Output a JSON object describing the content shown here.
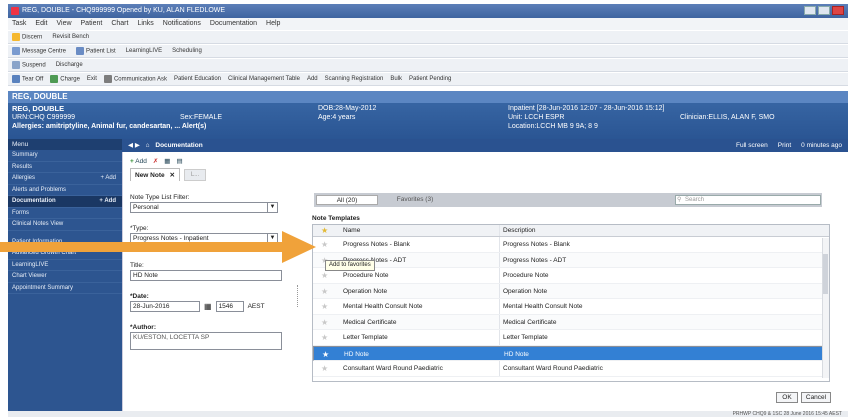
{
  "window": {
    "title": "REG, DOUBLE - CHQ999999 Opened by KU, ALAN FLEDLOWE"
  },
  "menu": [
    "Task",
    "Edit",
    "View",
    "Patient",
    "Chart",
    "Links",
    "Notifications",
    "Documentation",
    "Help"
  ],
  "toolbar_rows": {
    "row1": [
      "Discern",
      "Revisit Bench"
    ],
    "row2": [
      "Message Centre",
      "Patient List",
      "LearningLIVE",
      "Scheduling"
    ],
    "row3": [
      "Suspend",
      "Discharge"
    ],
    "row4": [
      "Tear Off",
      "Charge",
      "Exit",
      "Communication Ask",
      "Patient Education",
      "Clinical Management Table",
      "Add",
      "Scanning Registration",
      "Bulk",
      "Patient Pending"
    ]
  },
  "banner": {
    "name_bar": "REG, DOUBLE",
    "name": "REG, DOUBLE",
    "urn": "URN:CHQ C999999",
    "sex": "Sex:FEMALE",
    "dob": "DOB:28-May-2012",
    "age": "Age:4 years",
    "allergies": "Allergies: amitriptyline, Animal fur, candesartan, ... Alert(s)",
    "inpatient": "Inpatient [28-Jun-2016 12:07 - 28-Jun-2016 15:12]",
    "unit": "Unit: LCCH ESPR",
    "location": "Location:LCCH MB 9 9A; 8 9",
    "clinician": "Clinician:ELLIS, ALAN F, SMO"
  },
  "sidebar": {
    "menu_label": "Menu",
    "items": [
      {
        "label": "Summary",
        "add": ""
      },
      {
        "label": "Results",
        "add": ""
      },
      {
        "label": "Allergies",
        "add": "+ Add"
      },
      {
        "label": "Alerts and Problems",
        "add": ""
      },
      {
        "label": "Documentation",
        "add": "+ Add",
        "active": true
      },
      {
        "label": "Forms",
        "add": ""
      },
      {
        "label": "Clinical Notes View",
        "add": ""
      },
      {
        "label": "Patient Information",
        "add": ""
      },
      {
        "label": "Advanced Growth Chart",
        "add": ""
      },
      {
        "label": "LearningLIVE",
        "add": ""
      },
      {
        "label": "Chart Viewer",
        "add": ""
      },
      {
        "label": "Appointment Summary",
        "add": ""
      }
    ]
  },
  "crumb": {
    "title": "Documentation",
    "fullscreen": "Full screen",
    "print": "Print",
    "refresh": "0 minutes ago"
  },
  "doc_toolbar": {
    "add": "Add"
  },
  "note_tabs": {
    "active": "New Note",
    "second": "L..."
  },
  "form": {
    "note_type_filter_label": "Note Type List Filter:",
    "note_type_filter_value": "Personal",
    "type_label": "*Type:",
    "type_value": "Progress Notes - Inpatient",
    "title_label": "Title:",
    "title_value": "HD Note",
    "date_label": "*Date:",
    "date_value": "28-Jun-2016",
    "time_value": "1546",
    "time_tz": "AEST",
    "author_label": "*Author:",
    "author_value": "KU/ESTON, LOCETTA SP"
  },
  "templates_panel": {
    "tab_all": "All (20)",
    "tab_favorites": "Favorites (3)",
    "search_placeholder": "Search",
    "section_label": "Note Templates",
    "col_name": "Name",
    "col_description": "Description",
    "tooltip": "Add to favorites",
    "rows": [
      {
        "name": "Progress Notes - Blank",
        "description": "Progress Notes - Blank"
      },
      {
        "name": "Progress Notes - ADT",
        "description": "Progress Notes - ADT"
      },
      {
        "name": "Procedure Note",
        "description": "Procedure Note"
      },
      {
        "name": "Operation Note",
        "description": "Operation Note"
      },
      {
        "name": "Mental Health Consult Note",
        "description": "Mental Health Consult Note"
      },
      {
        "name": "Medical Certificate",
        "description": "Medical Certificate"
      },
      {
        "name": "Letter Template",
        "description": "Letter Template"
      },
      {
        "name": "HD Note",
        "description": "HD Note",
        "selected": true
      },
      {
        "name": "Consultant Ward Round Paediatric",
        "description": "Consultant Ward Round Paediatric"
      }
    ]
  },
  "buttons": {
    "ok": "OK",
    "cancel": "Cancel"
  },
  "status": "PRHWP  CHQ9 & 1SC  28 June 2016  15:45 AEST",
  "colors": {
    "banner": "#2a5593",
    "sidebar": "#2d5590",
    "selected_row": "#3380d4",
    "arrow": "#f0a23a"
  }
}
